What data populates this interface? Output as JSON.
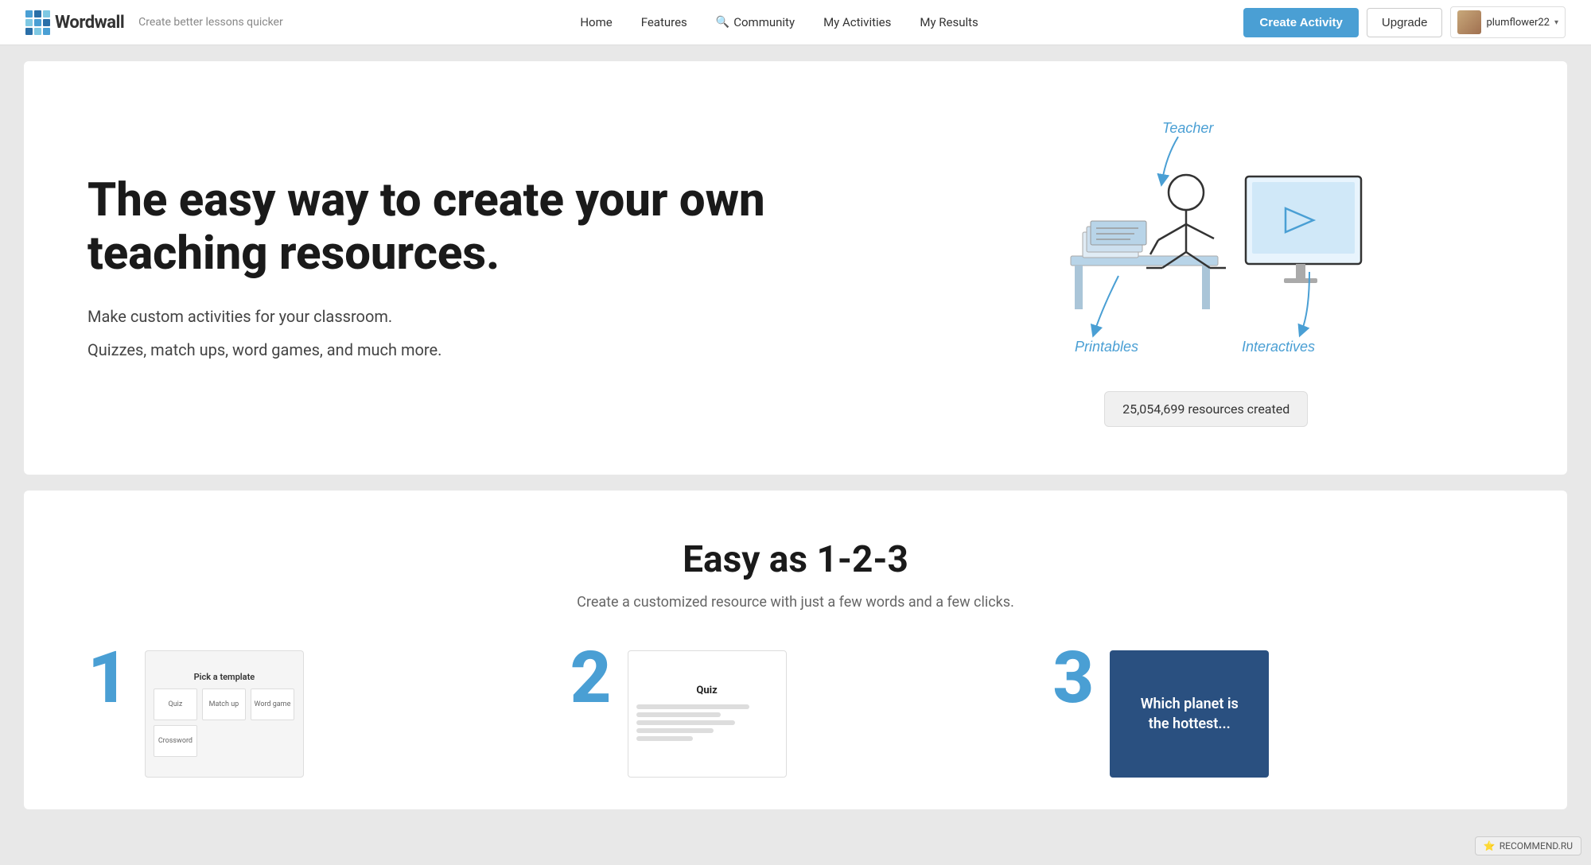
{
  "brand": {
    "name": "Wordwall",
    "tagline": "Create better lessons quicker"
  },
  "nav": {
    "home": "Home",
    "features": "Features",
    "community": "Community",
    "myActivities": "My Activities",
    "myResults": "My Results"
  },
  "actions": {
    "createActivity": "Create Activity",
    "upgrade": "Upgrade"
  },
  "user": {
    "name": "plumflower22",
    "chevron": "▾"
  },
  "hero": {
    "title": "The easy way to create your own teaching resources.",
    "line1": "Make custom activities for your classroom.",
    "line2": "Quizzes, match ups, word games, and much more.",
    "badge": "25,054,699 resources created",
    "illustration_labels": {
      "teacher": "Teacher",
      "printables": "Printables",
      "interactives": "Interactives"
    }
  },
  "easySection": {
    "title": "Easy as 1-2-3",
    "subtitle": "Create a customized resource with just a few words and a few clicks.",
    "steps": [
      {
        "number": "1",
        "cardTitle": "Pick a template",
        "lines": [
          "80",
          "60",
          "70"
        ]
      },
      {
        "number": "2",
        "cardTitle": "Quiz",
        "lines": [
          "80",
          "60",
          "70",
          "50"
        ]
      },
      {
        "number": "3",
        "cardText": "Which planet is the hottest..."
      }
    ]
  },
  "recommend": {
    "label": "RECOMMEND.RU",
    "icon": "★"
  }
}
